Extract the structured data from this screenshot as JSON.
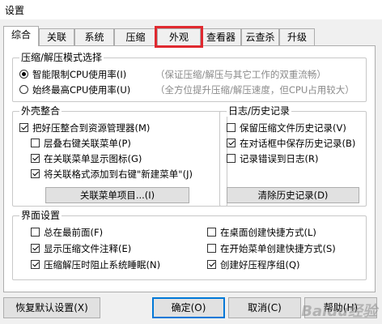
{
  "window": {
    "title": "设置"
  },
  "tabs": [
    {
      "label": "综合"
    },
    {
      "label": "关联"
    },
    {
      "label": "系统"
    },
    {
      "label": "压缩"
    },
    {
      "label": "外观"
    },
    {
      "label": "查看器"
    },
    {
      "label": "云查杀"
    },
    {
      "label": "升级"
    }
  ],
  "active_tab": "综合",
  "highlighted_tab": "外观",
  "highlight_color": "#e0292f",
  "compress_mode": {
    "title": "压缩/解压模式选择",
    "options": [
      {
        "label": "智能限制CPU使用率(I)",
        "hint": "（保证压缩/解压与其它工作的双重流畅）",
        "checked": true
      },
      {
        "label": "始终最高CPU使用率(U)",
        "hint": "（全方位提升压缩/解压速度，但CPU占用较大）",
        "checked": false
      }
    ]
  },
  "shell": {
    "title": "外壳整合",
    "items": [
      {
        "label": "把好压整合到资源管理器(M)",
        "checked": true
      },
      {
        "label": "层叠右键关联菜单(P)",
        "checked": false
      },
      {
        "label": "在关联菜单显示图标(G)",
        "checked": true
      },
      {
        "label": "将关联格式添加到右键\"新建菜单\"(J)",
        "checked": true
      }
    ],
    "button": "关联菜单项目...(I)"
  },
  "log": {
    "title": "日志/历史记录",
    "items": [
      {
        "label": "保留压缩文件历史记录(V)",
        "checked": false
      },
      {
        "label": "在对话框中保存历史记录(B)",
        "checked": true
      },
      {
        "label": "记录错误到日志(R)",
        "checked": false
      }
    ],
    "button": "清除历史记录(D)"
  },
  "ui": {
    "title": "界面设置",
    "left": [
      {
        "label": "总在最前面(F)",
        "checked": false
      },
      {
        "label": "显示压缩文件注释(E)",
        "checked": true
      },
      {
        "label": "压缩解压时阻止系统睡眠(N)",
        "checked": true
      }
    ],
    "right": [
      {
        "label": "在桌面创建快捷方式(L)",
        "checked": false
      },
      {
        "label": "在开始菜单创建快捷方式(S)",
        "checked": false
      },
      {
        "label": "创建好压程序组(Q)",
        "checked": true
      }
    ]
  },
  "footer": {
    "restore": "恢复默认设置(X)",
    "ok": "确定(O)",
    "cancel": "取消(C)",
    "help": "帮助(H)"
  },
  "watermark": "Baidu经验"
}
